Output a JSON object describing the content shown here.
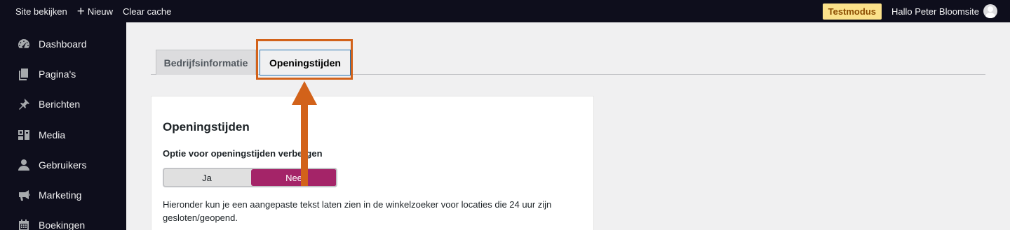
{
  "adminbar": {
    "site_label": "Site bekijken",
    "new_label": "Nieuw",
    "clear_cache_label": "Clear cache",
    "testmode_badge": "Testmodus",
    "greeting": "Hallo Peter Bloomsite"
  },
  "sidebar": {
    "items": [
      {
        "label": "Dashboard",
        "icon": "dashboard-icon"
      },
      {
        "label": "Pagina's",
        "icon": "pages-icon"
      },
      {
        "label": "Berichten",
        "icon": "pin-icon"
      },
      {
        "label": "Media",
        "icon": "media-icon"
      },
      {
        "label": "Gebruikers",
        "icon": "user-icon"
      },
      {
        "label": "Marketing",
        "icon": "megaphone-icon"
      },
      {
        "label": "Boekingen",
        "icon": "calendar-icon"
      }
    ]
  },
  "tabs": [
    {
      "label": "Bedrijfsinformatie",
      "active": false
    },
    {
      "label": "Openingstijden",
      "active": true
    }
  ],
  "panel": {
    "title": "Openingstijden",
    "option_label": "Optie voor openingstijden verbergen",
    "toggle": {
      "options": [
        "Ja",
        "Nee"
      ],
      "selected": "Nee"
    },
    "description": "Hieronder kun je een aangepaste tekst laten zien in de winkelzoeker voor locaties die 24 uur zijn gesloten/geopend."
  },
  "colors": {
    "adminbar_bg": "#0e0e1c",
    "toggle_selected": "#a42468",
    "highlight": "#d2621a",
    "testmode_bg": "#fbe18a"
  }
}
